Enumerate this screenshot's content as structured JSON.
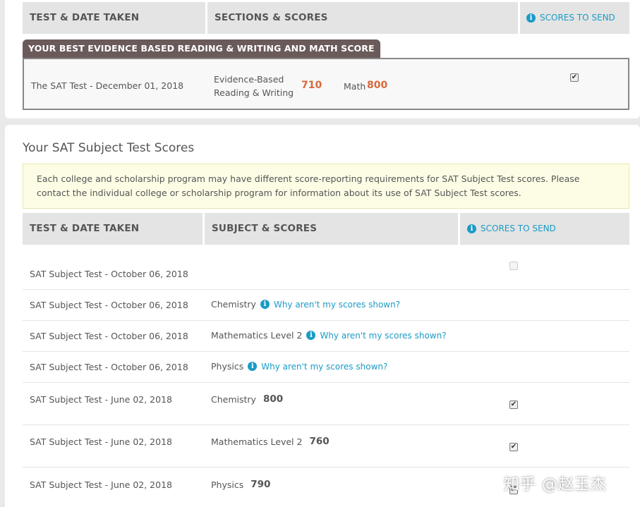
{
  "top_table": {
    "headers": {
      "test_date": "TEST & DATE TAKEN",
      "sections": "SECTIONS & SCORES",
      "send": "SCORES TO SEND"
    },
    "best_badge": "YOUR BEST EVIDENCE BASED READING & WRITING AND MATH SCORE",
    "best_row": {
      "test": "The SAT Test - December 01, 2018",
      "ebrw_label_line1": "Evidence-Based",
      "ebrw_label_line2": "Reading & Writing",
      "ebrw_score": "710",
      "math_label": "Math",
      "math_score": "800",
      "send_checked": true
    }
  },
  "subject_section": {
    "title": "Your SAT Subject Test Scores",
    "notice": "Each college and scholarship program may have different score-reporting requirements for SAT Subject Test scores. Please contact the individual college or scholarship program for information about its use of SAT Subject Test scores.",
    "headers": {
      "test_date": "TEST & DATE TAKEN",
      "subjects": "SUBJECT & SCORES",
      "send": "SCORES TO SEND"
    },
    "rows": [
      {
        "date": "SAT Subject Test - October 06, 2018",
        "subject": "",
        "score": "",
        "why": "",
        "checkbox": "disabled"
      },
      {
        "date": "SAT Subject Test - October 06, 2018",
        "subject": "Chemistry",
        "score": "",
        "why": "Why aren't my scores shown?",
        "checkbox": "none"
      },
      {
        "date": "SAT Subject Test - October 06, 2018",
        "subject": "Mathematics Level 2",
        "score": "",
        "why": "Why aren't my scores shown?",
        "checkbox": "none"
      },
      {
        "date": "SAT Subject Test - October 06, 2018",
        "subject": "Physics",
        "score": "",
        "why": "Why aren't my scores shown?",
        "checkbox": "none"
      },
      {
        "date": "SAT Subject Test - June 02, 2018",
        "subject": "Chemistry",
        "score": "800",
        "why": "",
        "checkbox": "checked"
      },
      {
        "date": "SAT Subject Test - June 02, 2018",
        "subject": "Mathematics Level 2",
        "score": "760",
        "why": "",
        "checkbox": "checked"
      },
      {
        "date": "SAT Subject Test - June 02, 2018",
        "subject": "Physics",
        "score": "790",
        "why": "",
        "checkbox": "checked"
      }
    ]
  },
  "icons": {
    "info": "info-icon",
    "check": "checkmark-icon"
  },
  "colors": {
    "accent": "#1a9bc6",
    "score": "#d9683a",
    "badge": "#6a5a5a",
    "notice_bg": "#fdfde6"
  },
  "watermark": "知乎 @赵玉杰"
}
